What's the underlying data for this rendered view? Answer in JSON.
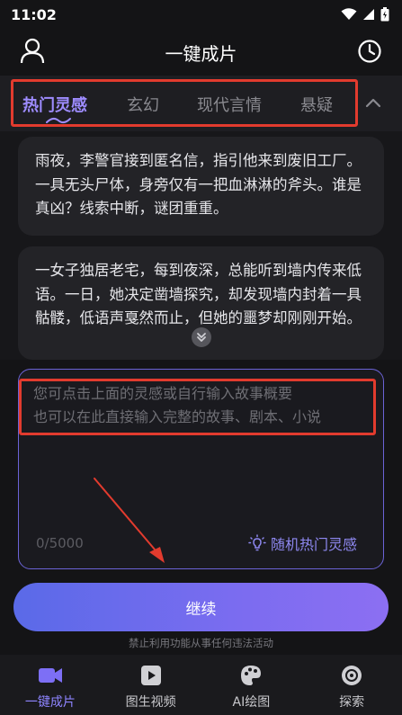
{
  "status_bar": {
    "time": "11:02",
    "icons": [
      "wifi-icon",
      "signal-icon",
      "battery-icon"
    ]
  },
  "header": {
    "title": "一键成片",
    "left_icon": "profile-icon",
    "right_icon": "history-clock-icon"
  },
  "tabs": [
    {
      "label": "热门灵感",
      "active": true
    },
    {
      "label": "玄幻",
      "active": false
    },
    {
      "label": "现代言情",
      "active": false
    },
    {
      "label": "悬疑",
      "active": false
    }
  ],
  "inspiration_cards": [
    {
      "text": "雨夜，李警官接到匿名信，指引他来到废旧工厂。一具无头尸体，身旁仅有一把血淋淋的斧头。谁是真凶？线索中断，谜团重重。"
    },
    {
      "text": "一女子独居老宅，每到夜深，总能听到墙内传来低语。一日，她决定凿墙探究，却发现墙内封着一具骷髅，低语声戛然而止，但她的噩梦却刚刚开始。"
    }
  ],
  "story_input": {
    "value": "",
    "placeholder": "您可点击上面的灵感或自行输入故事概要\n也可以在此直接输入完整的故事、剧本、小说"
  },
  "char_counter": "0/5000",
  "random_button": {
    "label": "随机热门灵感",
    "icon": "lightbulb-icon"
  },
  "continue_button": {
    "label": "继续"
  },
  "disclaimer": "禁止利用功能从事任何违法活动",
  "bottom_nav": [
    {
      "label": "一键成片",
      "icon": "video-camera-icon",
      "active": true
    },
    {
      "label": "图生视频",
      "icon": "play-image-icon",
      "active": false
    },
    {
      "label": "AI绘图",
      "icon": "palette-icon",
      "active": false
    },
    {
      "label": "探索",
      "icon": "compass-icon",
      "active": false
    }
  ],
  "colors": {
    "background": "#141416",
    "accent": "#8e84ff",
    "annotation_red": "#e23b2e",
    "button_gradient_start": "#5a6ae8",
    "button_gradient_end": "#8c6ff2"
  }
}
